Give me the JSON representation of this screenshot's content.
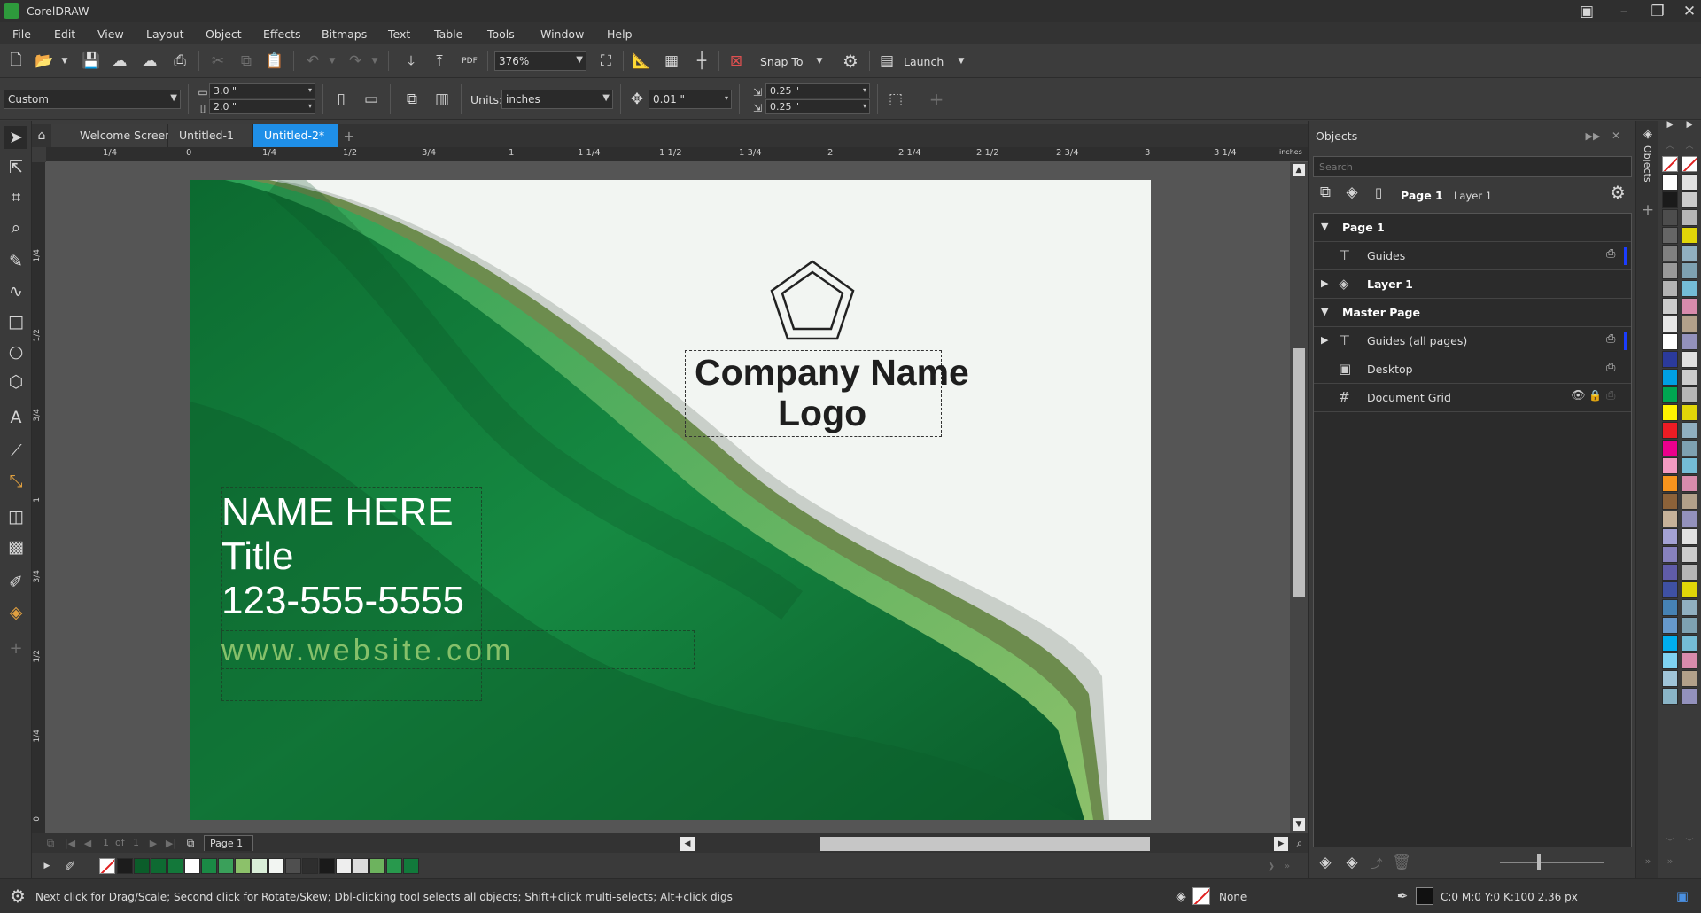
{
  "app": {
    "title": "CorelDRAW"
  },
  "menu": [
    "File",
    "Edit",
    "View",
    "Layout",
    "Object",
    "Effects",
    "Bitmaps",
    "Text",
    "Table",
    "Tools",
    "Window",
    "Help"
  ],
  "toolbar": {
    "zoom": "376%",
    "snap_to": "Snap To",
    "launch": "Launch",
    "pdf": "PDF"
  },
  "property_bar": {
    "page_size": "Custom",
    "width": "3.0 \"",
    "height": "2.0 \"",
    "units_label": "Units:",
    "units": "inches",
    "nudge": "0.01 \"",
    "dup_x": "0.25 \"",
    "dup_y": "0.25 \""
  },
  "tabs": [
    "Welcome Screen",
    "Untitled-1",
    "Untitled-2*"
  ],
  "ruler": {
    "units": "inches",
    "h_ticks": [
      "1/4",
      "0",
      "1/4",
      "1/2",
      "3/4",
      "1",
      "1 1/4",
      "1 1/2",
      "1 3/4",
      "2",
      "2 1/4",
      "2 1/2",
      "2 3/4",
      "3",
      "3 1/4"
    ],
    "v_ticks": [
      "1/4",
      "1/2",
      "3/4",
      "1",
      "3/4",
      "1/2",
      "1/4",
      "0"
    ]
  },
  "card": {
    "company_line1": "Company Name",
    "company_line2": "Logo",
    "name": "NAME HERE",
    "title": "Title",
    "phone": "123-555-5555",
    "website": "www.website.com"
  },
  "page_nav": {
    "current": "1",
    "of": "of",
    "total": "1",
    "page_tab": "Page 1"
  },
  "objects_panel": {
    "title": "Objects",
    "search_placeholder": "Search",
    "vertical_tab": "Objects",
    "current_page": "Page 1",
    "current_layer": "Layer 1",
    "rows": [
      {
        "label": "Page 1",
        "bold": true,
        "level": 0,
        "expander": "open"
      },
      {
        "label": "Guides",
        "bold": false,
        "level": 1,
        "expander": "none"
      },
      {
        "label": "Layer 1",
        "bold": true,
        "level": 1,
        "expander": "closed"
      },
      {
        "label": "Master Page",
        "bold": true,
        "level": 0,
        "expander": "open"
      },
      {
        "label": "Guides (all pages)",
        "bold": false,
        "level": 1,
        "expander": "closed"
      },
      {
        "label": "Desktop",
        "bold": false,
        "level": 1,
        "expander": "none"
      },
      {
        "label": "Document Grid",
        "bold": false,
        "level": 1,
        "expander": "none"
      }
    ]
  },
  "status": {
    "hint": "Next click for Drag/Scale; Second click for Rotate/Skew; Dbl-clicking tool selects all objects; Shift+click multi-selects; Alt+click digs",
    "fill": "None",
    "outline": "C:0 M:0 Y:0 K:100  2.36 px"
  },
  "colors": {
    "accent": "#1f8fe8",
    "card_green_dark": "#0e6a32",
    "card_green_mid": "#1a8a45",
    "card_green_light": "#8cc16a",
    "website_green": "#86c06a"
  },
  "doc_palette": [
    "#1c1c1c",
    "#0b5d2a",
    "#0e6a32",
    "#13783a",
    "#ffffff",
    "#1a8a45",
    "#3aa05a",
    "#8cc16a",
    "#d9eed8",
    "#f2f5f2",
    "#4f4f4f",
    "#2e2e2e",
    "#1a1a1a",
    "#eeeeee",
    "#dcdcdc",
    "#6db35e",
    "#28994d",
    "#117a3b"
  ],
  "color_strip": [
    "#ffffff",
    "#1a1a1a",
    "#4d4d4d",
    "#666666",
    "#808080",
    "#999999",
    "#b3b3b3",
    "#cccccc",
    "#e6e6e6",
    "#ffffff",
    "#2b3a9b",
    "#00a0e3",
    "#00a651",
    "#fff200",
    "#ed1c24",
    "#ec008c",
    "#f49ac1",
    "#f7941d",
    "#8c6239",
    "#c7b299",
    "#a3a1d3",
    "#8781bd",
    "#605ca8",
    "#3f51a3",
    "#4682b4",
    "#6699cc",
    "#00aeef",
    "#7fd3f2",
    "#a0c4d8",
    "#8ab4c6"
  ]
}
